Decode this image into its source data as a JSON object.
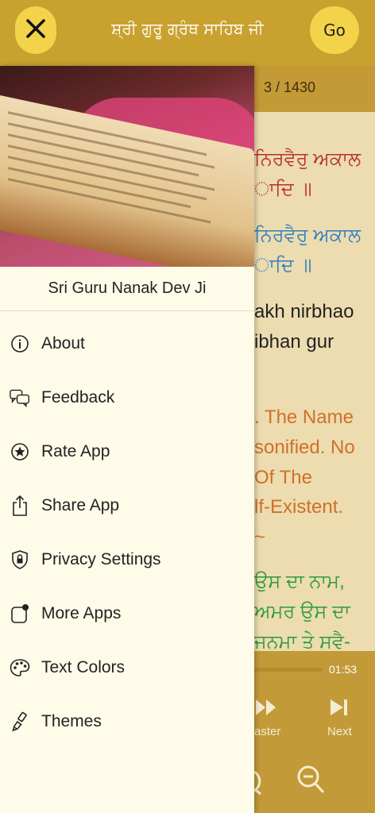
{
  "header": {
    "title": "ਸ਼੍ਰੀ ਗੁਰੂ ਗ੍ਰੰਥ ਸਾਹਿਬ ਜੀ",
    "close_icon": "close-icon",
    "go_label": "Go"
  },
  "reader": {
    "page_indicator": "3 / 1430",
    "lines": [
      "ਨਿਰਵੈਰੁ ਅਕਾਲ",
      "ਾਦਿ ॥",
      "ਨਿਰਵੈਰੁ ਅਕਾਲ",
      "ਾਦਿ ॥",
      "akh nirbhao",
      "ibhan gur",
      ". The Name",
      "sonified. No",
      " Of The",
      "lf-Existent.",
      "~",
      "ਉਸ ਦਾ ਨਾਮ,",
      "ਅਮਰ ਉਸ ਦਾ",
      "ਜਨਮਾ ਤੇ ਸਵੈ-"
    ],
    "timestamp": "01:53",
    "controls": [
      "aster",
      "Next"
    ]
  },
  "drawer": {
    "heading": "Sri Guru Nanak Dev Ji",
    "menu": [
      {
        "label": "About",
        "icon": "info-icon"
      },
      {
        "label": "Feedback",
        "icon": "chat-bubbles-icon"
      },
      {
        "label": "Rate App",
        "icon": "star-circle-icon"
      },
      {
        "label": "Share App",
        "icon": "share-icon"
      },
      {
        "label": "Privacy Settings",
        "icon": "shield-lock-icon"
      },
      {
        "label": "More Apps",
        "icon": "app-badge-icon"
      },
      {
        "label": "Text Colors",
        "icon": "palette-icon"
      },
      {
        "label": "Themes",
        "icon": "paintbrush-icon"
      }
    ]
  },
  "colors": {
    "header_bg": "#c9a12e",
    "button_yellow": "#f3d34a",
    "drawer_bg": "#fffbe9",
    "reader_bg": "#ecdcb0",
    "gurmukhi_red": "#b8312e",
    "gurmukhi_blue": "#2f7fc0",
    "translation_orange": "#d0702a",
    "punjabi_green": "#2e9a3a"
  }
}
